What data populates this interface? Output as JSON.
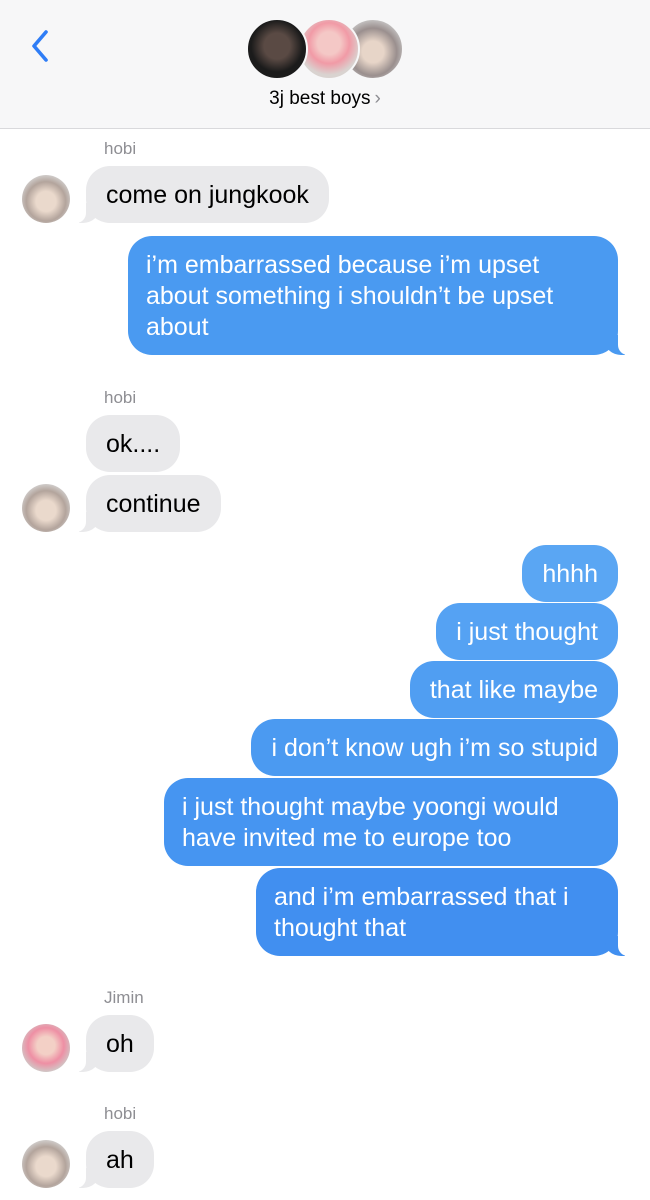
{
  "header": {
    "back_icon": "chevron-left-icon",
    "group_name": "3j best boys",
    "group_chevron": "›",
    "avatars": [
      "member-avatar-1",
      "member-avatar-2",
      "member-avatar-3"
    ]
  },
  "colors": {
    "incoming_bubble": "#e9e9eb",
    "outgoing_bubble": "#4a9af1",
    "accent": "#2f7df6",
    "sender_name": "#8e8e93"
  },
  "messages": [
    {
      "sender": "hobi",
      "text": "come on jungkook",
      "direction": "incoming"
    },
    {
      "text": "i’m embarrassed because i’m upset about something i shouldn’t be upset about",
      "direction": "outgoing"
    },
    {
      "sender": "hobi",
      "text": "ok....",
      "direction": "incoming"
    },
    {
      "text": "continue",
      "direction": "incoming"
    },
    {
      "text": "hhhh",
      "direction": "outgoing"
    },
    {
      "text": "i just thought",
      "direction": "outgoing"
    },
    {
      "text": "that like maybe",
      "direction": "outgoing"
    },
    {
      "text": "i don’t know ugh i’m so stupid",
      "direction": "outgoing"
    },
    {
      "text": "i just thought maybe yoongi would have invited me to europe too",
      "direction": "outgoing"
    },
    {
      "text": "and i’m embarrassed that i thought that",
      "direction": "outgoing"
    },
    {
      "sender": "Jimin",
      "text": "oh",
      "direction": "incoming"
    },
    {
      "sender": "hobi",
      "text": "ah",
      "direction": "incoming"
    }
  ]
}
